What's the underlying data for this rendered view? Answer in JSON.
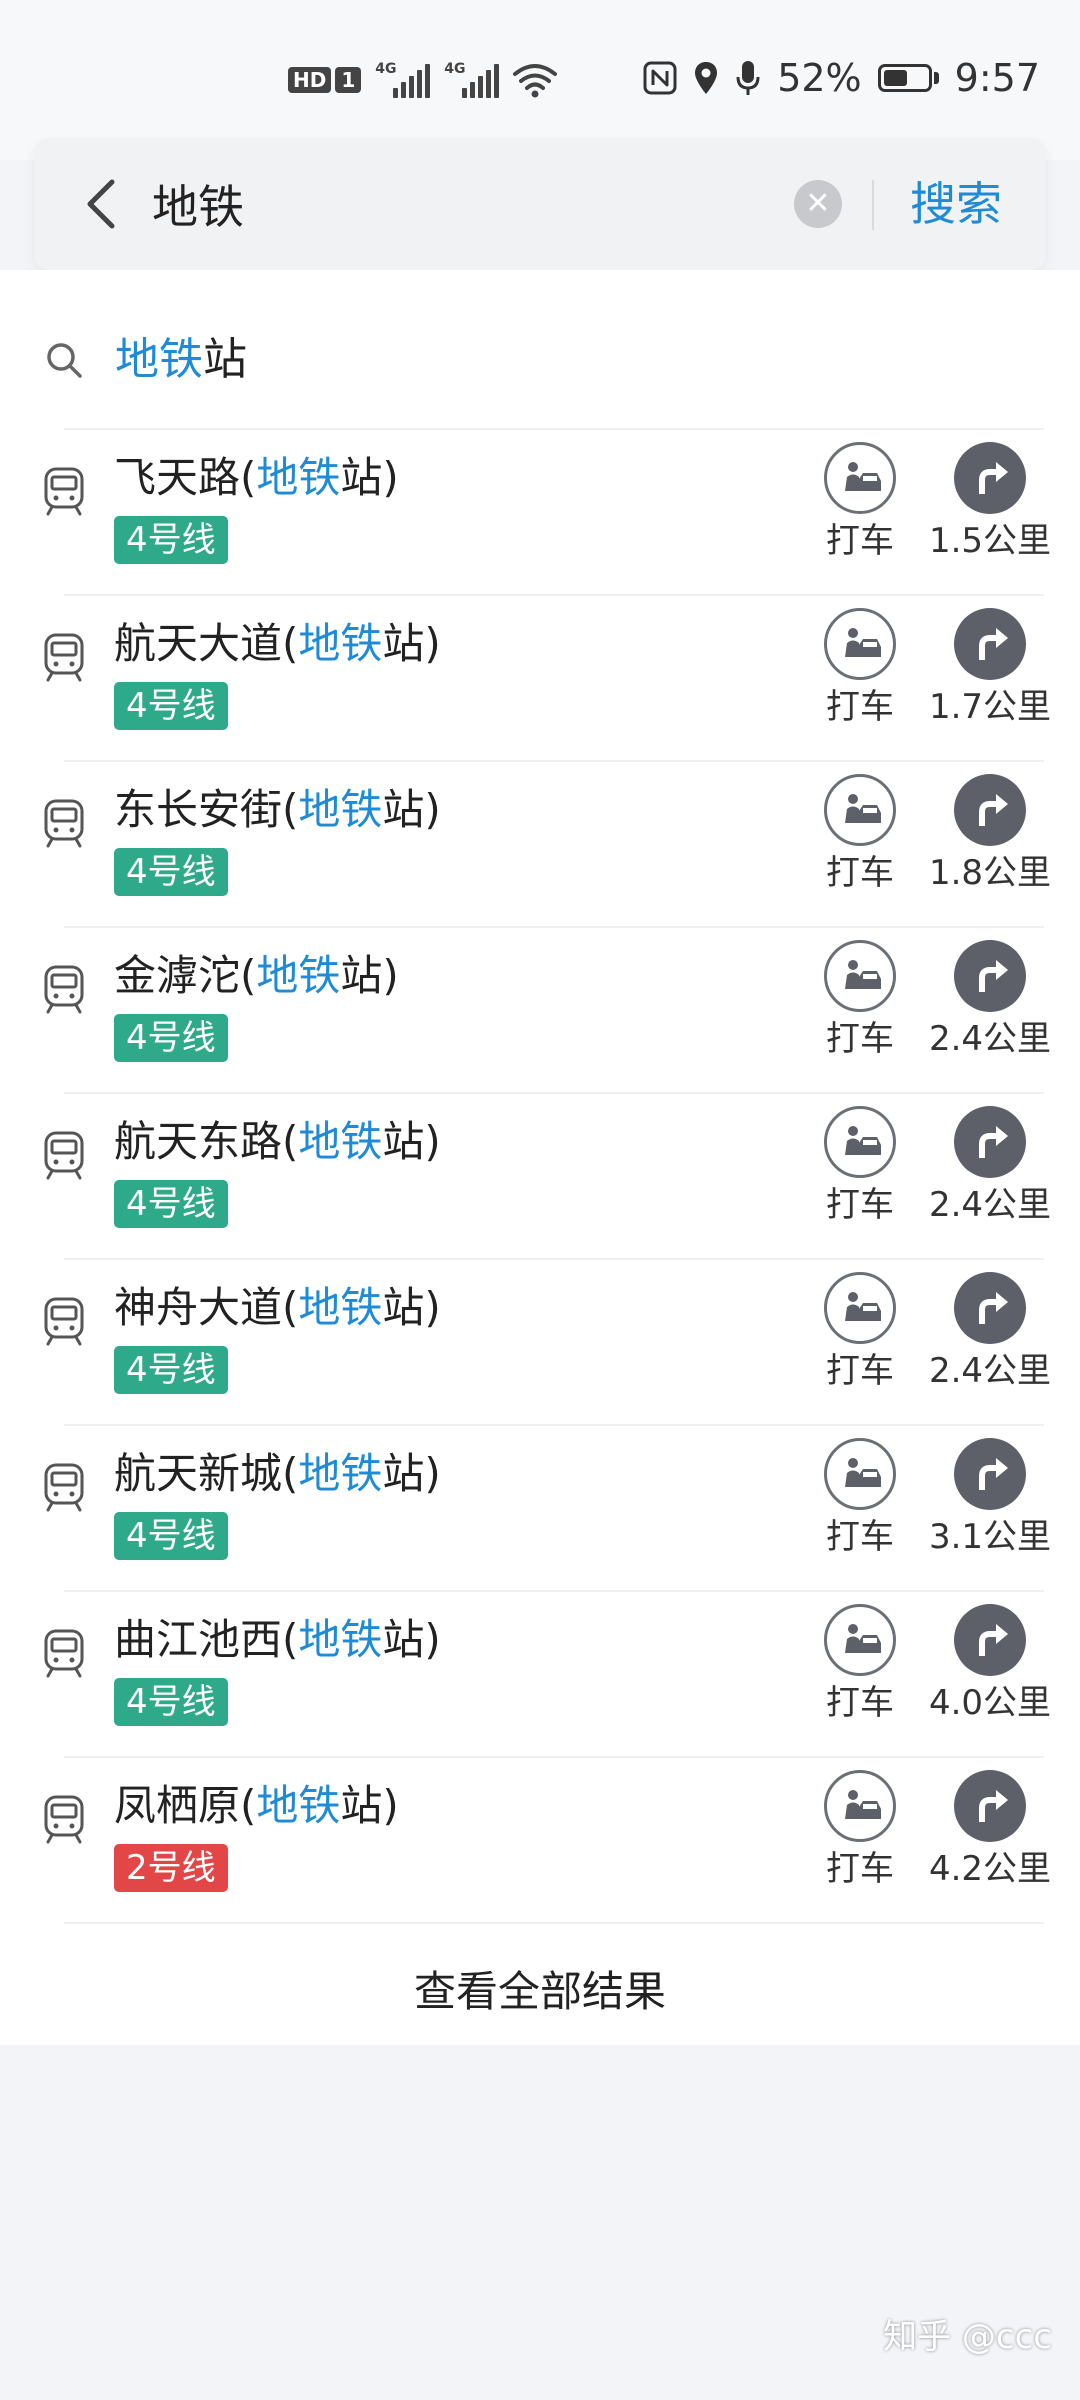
{
  "status_bar": {
    "hd": "HD",
    "sim": "1",
    "network1": "4G",
    "network2": "4G",
    "battery": "52%",
    "time": "9:57",
    "icons": [
      "nfc-icon",
      "location-icon",
      "microphone-icon",
      "battery-icon",
      "wifi-icon"
    ]
  },
  "search": {
    "query": "地铁",
    "search_label": "搜索"
  },
  "suggestion": {
    "highlight": "地铁",
    "rest": "站"
  },
  "results": [
    {
      "name": "飞天路",
      "open": "(",
      "highlight": "地铁",
      "tail": "站)",
      "line": "4号线",
      "line_color": "#2ea98a",
      "taxi": "打车",
      "distance": "1.5公里"
    },
    {
      "name": "航天大道",
      "open": "(",
      "highlight": "地铁",
      "tail": "站)",
      "line": "4号线",
      "line_color": "#2ea98a",
      "taxi": "打车",
      "distance": "1.7公里"
    },
    {
      "name": "东长安街",
      "open": "(",
      "highlight": "地铁",
      "tail": "站)",
      "line": "4号线",
      "line_color": "#2ea98a",
      "taxi": "打车",
      "distance": "1.8公里"
    },
    {
      "name": "金滹沱",
      "open": "(",
      "highlight": "地铁",
      "tail": "站)",
      "line": "4号线",
      "line_color": "#2ea98a",
      "taxi": "打车",
      "distance": "2.4公里"
    },
    {
      "name": "航天东路",
      "open": "(",
      "highlight": "地铁",
      "tail": "站)",
      "line": "4号线",
      "line_color": "#2ea98a",
      "taxi": "打车",
      "distance": "2.4公里"
    },
    {
      "name": "神舟大道",
      "open": "(",
      "highlight": "地铁",
      "tail": "站)",
      "line": "4号线",
      "line_color": "#2ea98a",
      "taxi": "打车",
      "distance": "2.4公里"
    },
    {
      "name": "航天新城",
      "open": "(",
      "highlight": "地铁",
      "tail": "站)",
      "line": "4号线",
      "line_color": "#2ea98a",
      "taxi": "打车",
      "distance": "3.1公里"
    },
    {
      "name": "曲江池西",
      "open": "(",
      "highlight": "地铁",
      "tail": "站)",
      "line": "4号线",
      "line_color": "#2ea98a",
      "taxi": "打车",
      "distance": "4.0公里"
    },
    {
      "name": "凤栖原",
      "open": "(",
      "highlight": "地铁",
      "tail": "站)",
      "line": "2号线",
      "line_color": "#e34646",
      "taxi": "打车",
      "distance": "4.2公里"
    }
  ],
  "view_all": "查看全部结果",
  "watermark": "知乎 @ccc",
  "colors": {
    "accent": "#1f8bd6",
    "line4": "#2ea98a",
    "line2": "#e34646"
  }
}
